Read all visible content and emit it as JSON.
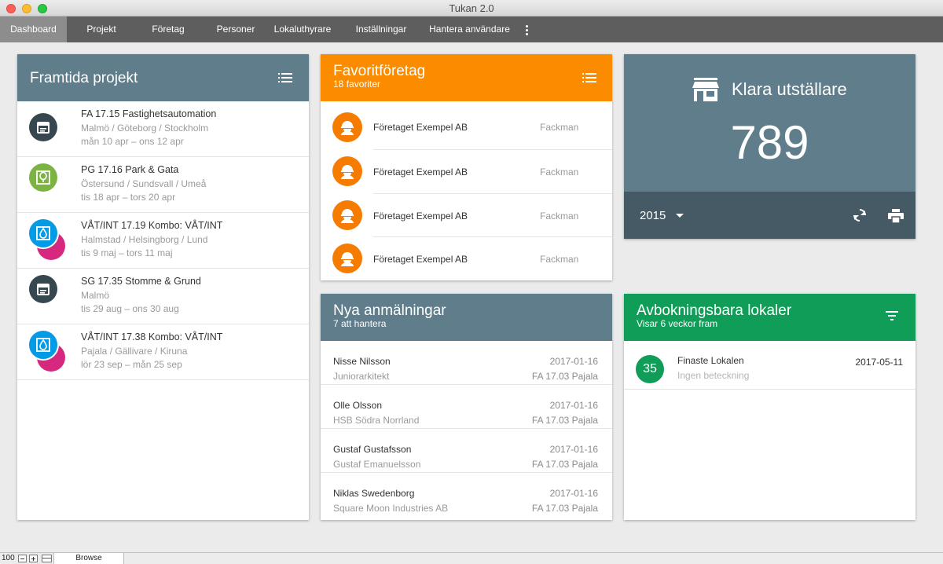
{
  "window": {
    "title": "Tukan 2.0"
  },
  "nav": {
    "items": [
      {
        "label": "Dashboard",
        "active": true
      },
      {
        "label": "Projekt"
      },
      {
        "label": "Företag"
      },
      {
        "label": "Personer"
      },
      {
        "label": "Lokaluthyrare"
      },
      {
        "label": "Inställningar"
      },
      {
        "label": "Hantera användare"
      }
    ],
    "more_icon": "more-vertical-icon"
  },
  "projects": {
    "title": "Framtida projekt",
    "menu_icon": "list-icon",
    "items": [
      {
        "title": "FA 17.15 Fastighetsautomation",
        "places": "Malmö / Göteborg / Stockholm",
        "dates": "mån 10 apr – ons 12 apr",
        "icon": "calendar-icon",
        "color": "#37474f"
      },
      {
        "title": "PG 17.16 Park & Gata",
        "places": "Östersund / Sundsvall / Umeå",
        "dates": "tis 18 apr – tors 20 apr",
        "icon": "tree-icon",
        "color": "#7cb342"
      },
      {
        "title": "VÅT/INT 17.19 Kombo: VÅT/INT",
        "places": "Halmstad / Helsingborg / Lund",
        "dates": "tis 9 maj – tors 11 maj",
        "icon": "water-drop-icon",
        "color": "#039be5",
        "secondary_color": "#d6287f"
      },
      {
        "title": "SG 17.35 Stomme & Grund",
        "places": "Malmö",
        "dates": "tis 29 aug – ons 30 aug",
        "icon": "calendar-icon",
        "color": "#37474f"
      },
      {
        "title": "VÅT/INT 17.38 Kombo: VÅT/INT",
        "places": "Pajala / Gällivare / Kiruna",
        "dates": "lör 23 sep – mån 25 sep",
        "icon": "water-drop-icon",
        "color": "#039be5",
        "secondary_color": "#d6287f"
      }
    ]
  },
  "favorites": {
    "title": "Favoritföretag",
    "subtitle": "18 favoriter",
    "menu_icon": "list-icon",
    "header_color": "#fb8c00",
    "items": [
      {
        "name": "Företaget Exempel AB",
        "type": "Fackman",
        "icon": "worker-icon"
      },
      {
        "name": "Företaget Exempel AB",
        "type": "Fackman",
        "icon": "worker-icon"
      },
      {
        "name": "Företaget Exempel AB",
        "type": "Fackman",
        "icon": "worker-icon"
      },
      {
        "name": "Företaget Exempel AB",
        "type": "Fackman",
        "icon": "worker-icon"
      }
    ]
  },
  "exhibitors": {
    "title": "Klara utställare",
    "count": "789",
    "year": "2015",
    "store_icon": "store-icon",
    "refresh_icon": "refresh-icon",
    "print_icon": "print-icon"
  },
  "registrations": {
    "title": "Nya anmälningar",
    "subtitle": "7 att hantera",
    "items": [
      {
        "name": "Nisse Nilsson",
        "title": "Juniorarkitekt",
        "date": "2017-01-16",
        "project": "FA 17.03 Pajala"
      },
      {
        "name": "Olle Olsson",
        "title": "HSB Södra Norrland",
        "date": "2017-01-16",
        "project": "FA 17.03 Pajala"
      },
      {
        "name": "Gustaf Gustafsson",
        "title": "Gustaf Emanuelsson",
        "date": "2017-01-16",
        "project": "FA 17.03 Pajala"
      },
      {
        "name": "Niklas Swedenborg",
        "title": "Square Moon Industries AB",
        "date": "2017-01-16",
        "project": "FA 17.03 Pajala"
      }
    ]
  },
  "venues": {
    "title": "Avbokningsbara lokaler",
    "subtitle": "Visar 6 veckor fram",
    "filter_icon": "filter-icon",
    "header_color": "#0f9d58",
    "items": [
      {
        "badge": "35",
        "name": "Finaste Lokalen",
        "desc": "Ingen beteckning",
        "date": "2017-05-11"
      }
    ]
  },
  "footer": {
    "zoom": "100",
    "mode": "Browse"
  }
}
